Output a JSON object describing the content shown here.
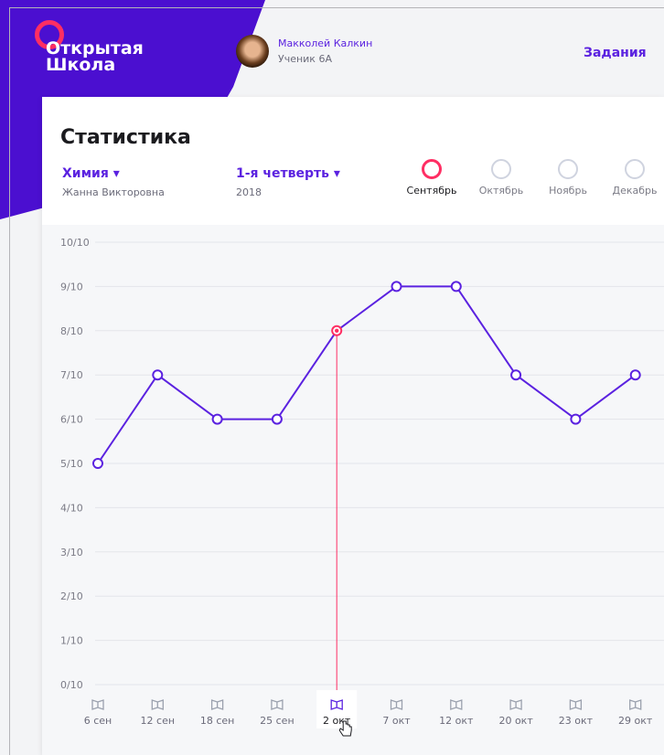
{
  "app": {
    "logo_line1": "Открытая",
    "logo_line2": "Школа"
  },
  "user": {
    "name": "Макколей Калкин",
    "class": "Ученик 6А"
  },
  "nav": {
    "tasks": "Задания"
  },
  "page": {
    "title": "Статистика"
  },
  "subject": {
    "label": "Химия ▾",
    "teacher": "Жанна Викторовна"
  },
  "quarter": {
    "label": "1-я четверть ▾",
    "year": "2018"
  },
  "months": [
    {
      "label": "Сентябрь",
      "active": true
    },
    {
      "label": "Октябрь",
      "active": false
    },
    {
      "label": "Ноябрь",
      "active": false
    },
    {
      "label": "Декабрь",
      "active": false
    }
  ],
  "colors": {
    "primary": "#5b22e0",
    "accent": "#ff2e63",
    "muted": "#9aa0ad"
  },
  "chart_data": {
    "type": "line",
    "x": [
      "6 сен",
      "12 сен",
      "18 сен",
      "25 сен",
      "2 окт",
      "7 окт",
      "12 окт",
      "20 окт",
      "23 окт",
      "29 окт"
    ],
    "series": [
      {
        "values": [
          5,
          7,
          6,
          6,
          8,
          9,
          9,
          7,
          6,
          7
        ]
      }
    ],
    "y_ticks": [
      "0/10",
      "1/10",
      "2/10",
      "3/10",
      "4/10",
      "5/10",
      "6/10",
      "7/10",
      "8/10",
      "9/10",
      "10/10"
    ],
    "ylim": [
      0,
      10
    ],
    "selected_index": 4,
    "grid": true
  }
}
